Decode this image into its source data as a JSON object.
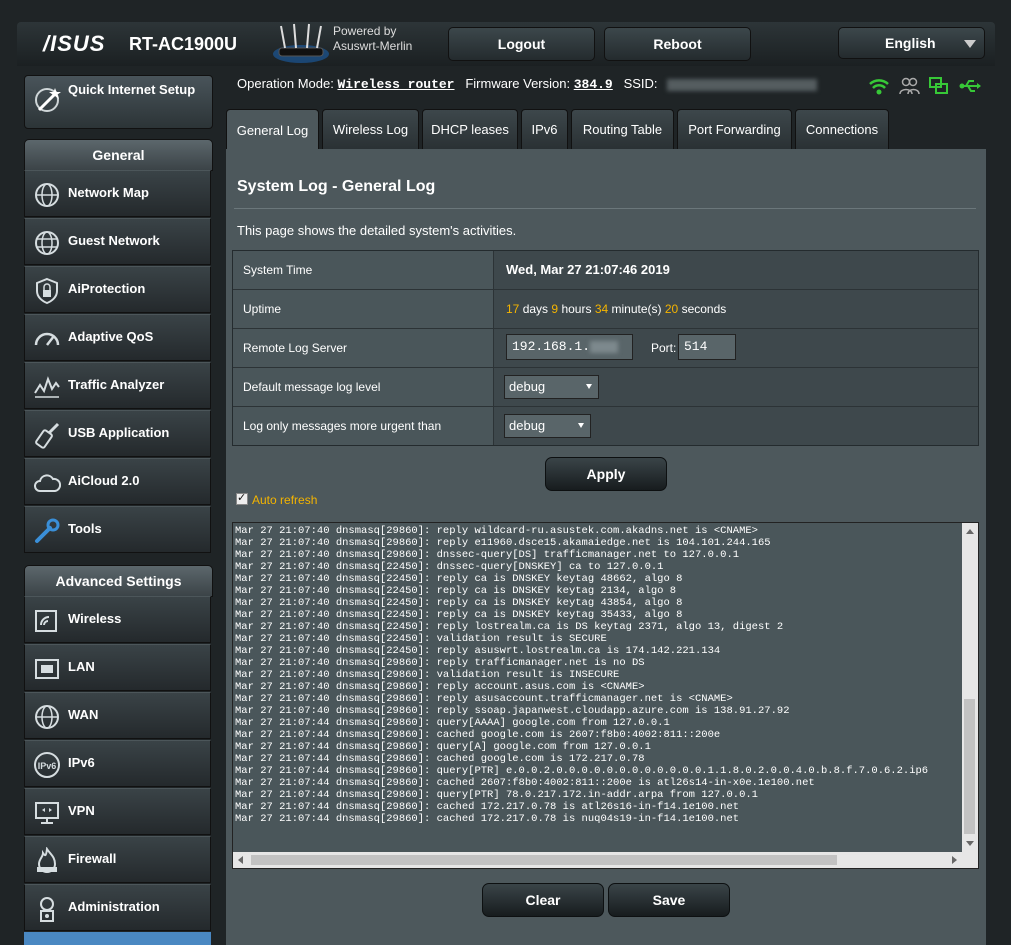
{
  "header": {
    "brand": "/ISUS",
    "model": "RT-AC1900U",
    "powered_by": "Powered by",
    "firmware_brand": "Asuswrt-Merlin",
    "logout_label": "Logout",
    "reboot_label": "Reboot",
    "language": "English"
  },
  "status": {
    "op_mode_label": "Operation Mode:",
    "op_mode_value": "Wireless router",
    "fw_label": "Firmware Version:",
    "fw_value": "384.9",
    "ssid_label": "SSID:",
    "icons": [
      "wifi-icon",
      "clients-icon",
      "network-status-icon",
      "usb-icon"
    ],
    "icon_color": "#37c837"
  },
  "sidebar": {
    "quick_setup": "Quick Internet Setup",
    "general_title": "General",
    "general_items": [
      {
        "label": "Network Map",
        "icon": "globe-network-icon"
      },
      {
        "label": "Guest Network",
        "icon": "guest-globe-icon"
      },
      {
        "label": "AiProtection",
        "icon": "lock-shield-icon"
      },
      {
        "label": "Adaptive QoS",
        "icon": "speedometer-icon"
      },
      {
        "label": "Traffic Analyzer",
        "icon": "traffic-graph-icon"
      },
      {
        "label": "USB Application",
        "icon": "usb-tools-icon"
      },
      {
        "label": "AiCloud 2.0",
        "icon": "cloud-icon"
      },
      {
        "label": "Tools",
        "icon": "wrench-icon"
      }
    ],
    "advanced_title": "Advanced Settings",
    "advanced_items": [
      {
        "label": "Wireless",
        "icon": "wireless-icon"
      },
      {
        "label": "LAN",
        "icon": "lan-icon"
      },
      {
        "label": "WAN",
        "icon": "wan-globe-icon"
      },
      {
        "label": "IPv6",
        "icon": "ipv6-icon"
      },
      {
        "label": "VPN",
        "icon": "vpn-icon"
      },
      {
        "label": "Firewall",
        "icon": "firewall-icon"
      },
      {
        "label": "Administration",
        "icon": "admin-icon"
      }
    ]
  },
  "tabs": [
    "General Log",
    "Wireless Log",
    "DHCP leases",
    "IPv6",
    "Routing Table",
    "Port Forwarding",
    "Connections"
  ],
  "page": {
    "title": "System Log - General Log",
    "description": "This page shows the detailed system's activities."
  },
  "settings": {
    "system_time_label": "System Time",
    "system_time_value": "Wed, Mar 27 21:07:46 2019",
    "uptime_label": "Uptime",
    "uptime": {
      "days": "17",
      "days_unit": "days",
      "hours": "9",
      "hours_unit": "hours",
      "minutes": "34",
      "minutes_unit": "minute(s)",
      "seconds": "20",
      "seconds_unit": "seconds"
    },
    "remote_log_label": "Remote Log Server",
    "remote_log_value": "192.168.1.",
    "port_label": "Port:",
    "port_value": "514",
    "default_level_label": "Default message log level",
    "default_level_value": "debug",
    "urgent_label": "Log only messages more urgent than",
    "urgent_value": "debug"
  },
  "apply_label": "Apply",
  "auto_refresh_label": "Auto refresh",
  "auto_refresh_checked": true,
  "log_lines": [
    "Mar 27 21:07:40 dnsmasq[29860]: reply wildcard-ru.asustek.com.akadns.net is <CNAME>",
    "Mar 27 21:07:40 dnsmasq[29860]: reply e11960.dsce15.akamaiedge.net is 104.101.244.165",
    "Mar 27 21:07:40 dnsmasq[29860]: dnssec-query[DS] trafficmanager.net to 127.0.0.1",
    "Mar 27 21:07:40 dnsmasq[22450]: dnssec-query[DNSKEY] ca to 127.0.0.1",
    "Mar 27 21:07:40 dnsmasq[22450]: reply ca is DNSKEY keytag 48662, algo 8",
    "Mar 27 21:07:40 dnsmasq[22450]: reply ca is DNSKEY keytag 2134, algo 8",
    "Mar 27 21:07:40 dnsmasq[22450]: reply ca is DNSKEY keytag 43854, algo 8",
    "Mar 27 21:07:40 dnsmasq[22450]: reply ca is DNSKEY keytag 35433, algo 8",
    "Mar 27 21:07:40 dnsmasq[22450]: reply lostrealm.ca is DS keytag 2371, algo 13, digest 2",
    "Mar 27 21:07:40 dnsmasq[22450]: validation result is SECURE",
    "Mar 27 21:07:40 dnsmasq[22450]: reply asuswrt.lostrealm.ca is 174.142.221.134",
    "Mar 27 21:07:40 dnsmasq[29860]: reply trafficmanager.net is no DS",
    "Mar 27 21:07:40 dnsmasq[29860]: validation result is INSECURE",
    "Mar 27 21:07:40 dnsmasq[29860]: reply account.asus.com is <CNAME>",
    "Mar 27 21:07:40 dnsmasq[29860]: reply asusaccount.trafficmanager.net is <CNAME>",
    "Mar 27 21:07:40 dnsmasq[29860]: reply ssoap.japanwest.cloudapp.azure.com is 138.91.27.92",
    "Mar 27 21:07:44 dnsmasq[29860]: query[AAAA] google.com from 127.0.0.1",
    "Mar 27 21:07:44 dnsmasq[29860]: cached google.com is 2607:f8b0:4002:811::200e",
    "Mar 27 21:07:44 dnsmasq[29860]: query[A] google.com from 127.0.0.1",
    "Mar 27 21:07:44 dnsmasq[29860]: cached google.com is 172.217.0.78",
    "Mar 27 21:07:44 dnsmasq[29860]: query[PTR] e.0.0.2.0.0.0.0.0.0.0.0.0.0.0.0.1.1.8.0.2.0.0.4.0.b.8.f.7.0.6.2.ip6",
    "Mar 27 21:07:44 dnsmasq[29860]: cached 2607:f8b0:4002:811::200e is atl26s14-in-x0e.1e100.net",
    "Mar 27 21:07:44 dnsmasq[29860]: query[PTR] 78.0.217.172.in-addr.arpa from 127.0.0.1",
    "Mar 27 21:07:44 dnsmasq[29860]: cached 172.217.0.78 is atl26s16-in-f14.1e100.net",
    "Mar 27 21:07:44 dnsmasq[29860]: cached 172.217.0.78 is nuq04s19-in-f14.1e100.net"
  ],
  "clear_label": "Clear",
  "save_label": "Save"
}
